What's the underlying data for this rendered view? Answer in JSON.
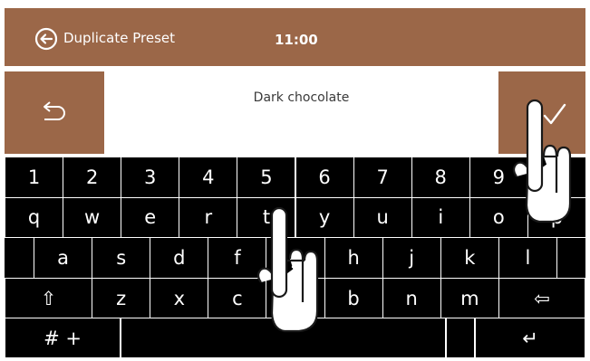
{
  "header": {
    "title": "Duplicate Preset",
    "time": "11:00",
    "back_icon": "circle-arrow-left-icon"
  },
  "input": {
    "value": "Dark chocolate"
  },
  "buttons": {
    "undo_icon": "undo-icon",
    "confirm_icon": "checkmark-icon"
  },
  "keyboard": {
    "number_row": [
      "1",
      "2",
      "3",
      "4",
      "5",
      "6",
      "7",
      "8",
      "9",
      "0"
    ],
    "row_q": [
      "q",
      "w",
      "e",
      "r",
      "t",
      "y",
      "u",
      "i",
      "o",
      "p"
    ],
    "row_a": [
      "a",
      "s",
      "d",
      "f",
      "g",
      "h",
      "j",
      "k",
      "l"
    ],
    "row_z": [
      "z",
      "x",
      "c",
      "v",
      "b",
      "n",
      "m"
    ],
    "shift_symbol": "⇧",
    "backspace_symbol": "⇦",
    "symbols_label": "# +",
    "enter_symbol": "↵"
  },
  "colors": {
    "brand": "#9b6748",
    "keyboard_bg": "#000000",
    "key_border": "#ffffff"
  }
}
